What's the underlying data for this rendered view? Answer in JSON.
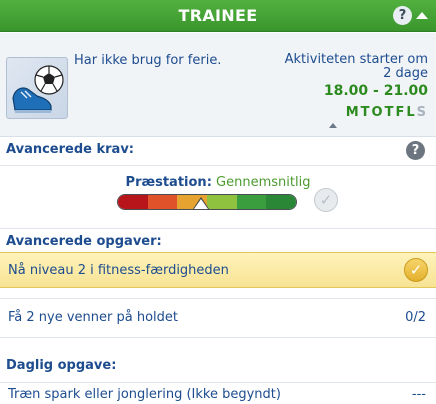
{
  "header": {
    "title": "TRAINEE",
    "help_icon": "?"
  },
  "activity": {
    "icon": "soccer-ball-boot-icon",
    "description": "Har ikke brug for ferie.",
    "start_label_line1": "Aktiviteten starter om",
    "start_label_line2": "2 dage",
    "time_range": "18.00 - 21.00",
    "days": [
      {
        "letter": "M",
        "active": true
      },
      {
        "letter": "T",
        "active": true
      },
      {
        "letter": "O",
        "active": true
      },
      {
        "letter": "T",
        "active": true
      },
      {
        "letter": "F",
        "active": true
      },
      {
        "letter": "L",
        "active": true
      },
      {
        "letter": "S",
        "active": false
      }
    ]
  },
  "advanced_requirements": {
    "heading": "Avancerede krav:",
    "help_icon": "?",
    "performance_label": "Præstation:",
    "performance_value": "Gennemsnitlig",
    "meter_colors": [
      "#b8151b",
      "#e0532a",
      "#e6a32f",
      "#8fc23f",
      "#3a9e3f",
      "#2a8736"
    ],
    "meter_level": 0.5
  },
  "advanced_tasks": {
    "heading": "Avancerede opgaver:",
    "items": [
      {
        "text": "Nå niveau 2 i fitness-færdigheden",
        "done": true
      },
      {
        "text": "Få 2 nye venner på holdet",
        "progress": "0/2"
      }
    ]
  },
  "daily_task": {
    "heading": "Daglig opgave:",
    "text": "Træn spark eller jonglering (Ikke begyndt)",
    "progress": "---"
  },
  "colors": {
    "header_green": "#46a536",
    "text_blue": "#1d4c8f",
    "time_green": "#2c8a1e",
    "done_gold": "#f7e394"
  }
}
